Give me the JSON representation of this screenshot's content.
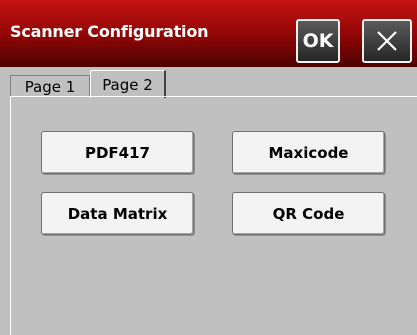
{
  "window": {
    "title": "Scanner Configuration",
    "ok_label": "OK",
    "close_icon": "close-icon"
  },
  "tabs": [
    {
      "label": "Page 1",
      "selected": false
    },
    {
      "label": "Page 2",
      "selected": true
    }
  ],
  "buttons": [
    {
      "label": "PDF417"
    },
    {
      "label": "Maxicode"
    },
    {
      "label": "Data Matrix"
    },
    {
      "label": "QR Code"
    }
  ],
  "colors": {
    "titlebar_top": "#c51313",
    "titlebar_bottom": "#4a0202",
    "panel_background": "#c0c0c0",
    "button_face": "#f3f3f3"
  }
}
